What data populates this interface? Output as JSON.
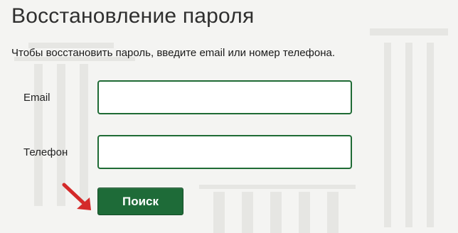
{
  "page": {
    "title": "Восстановление пароля",
    "instruction": "Чтобы восстановить пароль, введите email или номер телефона."
  },
  "form": {
    "email_label": "Email",
    "email_value": "",
    "phone_label": "Телефон",
    "phone_value": "",
    "search_label": "Поиск"
  },
  "colors": {
    "accent": "#1e6b38",
    "input_border": "#1f6b35",
    "arrow": "#d42a2a"
  }
}
